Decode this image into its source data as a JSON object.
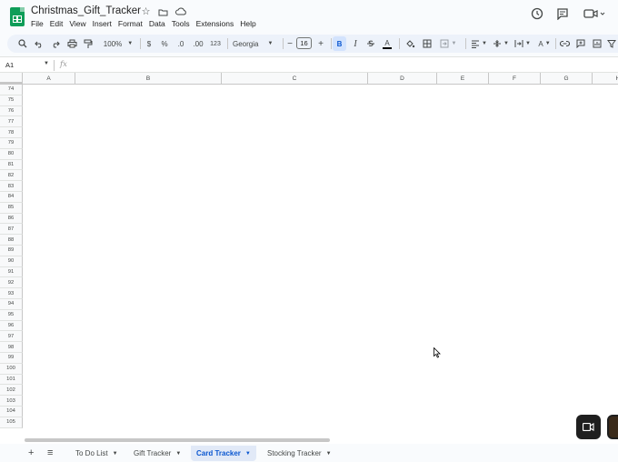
{
  "app": {
    "doc_title": "Christmas_Gift_Tracker",
    "menu": [
      "File",
      "Edit",
      "View",
      "Insert",
      "Format",
      "Data",
      "Tools",
      "Extensions",
      "Help"
    ]
  },
  "toolbar": {
    "zoom": "100%",
    "currency": "$",
    "percent": "%",
    "decrease_decimal": ".0",
    "increase_decimal": ".00",
    "number_format": "123",
    "font": "Georgia",
    "font_size": "16",
    "minus": "−",
    "plus": "+",
    "bold": "B",
    "italic": "I",
    "text_color": "A",
    "text_rotation": "A"
  },
  "formula_bar": {
    "cell_ref": "A1",
    "fx": "fx"
  },
  "grid": {
    "columns": [
      "A",
      "B",
      "C",
      "D",
      "E",
      "F",
      "G",
      "H"
    ],
    "rows": [
      "74",
      "75",
      "76",
      "77",
      "78",
      "79",
      "80",
      "81",
      "82",
      "83",
      "84",
      "85",
      "86",
      "87",
      "88",
      "89",
      "90",
      "91",
      "92",
      "93",
      "94",
      "95",
      "96",
      "97",
      "98",
      "99",
      "100",
      "101",
      "102",
      "103",
      "104",
      "105"
    ]
  },
  "sheets": {
    "add": "+",
    "all_sheets": "≡",
    "tabs": [
      {
        "label": "To Do List",
        "active": false
      },
      {
        "label": "Gift Tracker",
        "active": false
      },
      {
        "label": "Card Tracker",
        "active": true
      },
      {
        "label": "Stocking Tracker",
        "active": false
      }
    ]
  },
  "colors": {
    "accent": "#0b57d0",
    "sheets_green": "#0f9d58",
    "toolbar_bg": "#edf2fa",
    "active_tab_bg": "#e1e9f7"
  }
}
